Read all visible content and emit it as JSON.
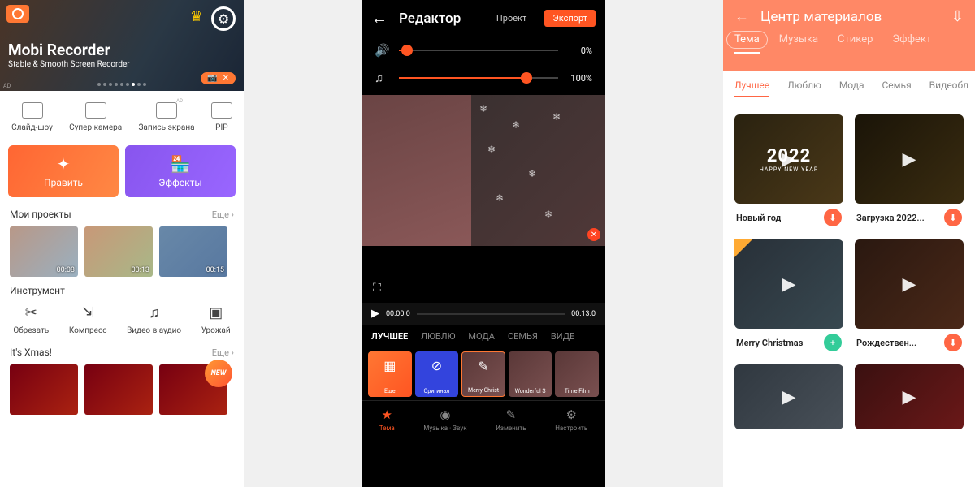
{
  "phone1": {
    "banner": {
      "title": "Mobi Recorder",
      "subtitle": "Stable & Smooth Screen Recorder",
      "ad": "AD"
    },
    "tools": [
      {
        "label": "Слайд-шоу"
      },
      {
        "label": "Супер камера"
      },
      {
        "label": "Запись экрана",
        "ad": "AD"
      },
      {
        "label": "PIP"
      }
    ],
    "edit_btn": "Править",
    "fx_btn": "Эффекты",
    "projects": {
      "title": "Мои проекты",
      "more": "Еще",
      "items": [
        {
          "dur": "00:08"
        },
        {
          "dur": "00:13"
        },
        {
          "dur": "00:15"
        }
      ]
    },
    "instruments": {
      "title": "Инструмент",
      "items": [
        {
          "label": "Обрезать"
        },
        {
          "label": "Компресс"
        },
        {
          "label": "Видео в аудио"
        },
        {
          "label": "Урожай"
        }
      ]
    },
    "xmas": {
      "title": "It's Xmas!",
      "more": "Еще",
      "new": "NEW"
    }
  },
  "phone2": {
    "title": "Редактор",
    "project": "Проект",
    "export": "Экспорт",
    "vol0": "0%",
    "vol100": "100%",
    "time_start": "00:00.0",
    "time_end": "00:13.0",
    "cats": [
      {
        "l": "ЛУЧШЕЕ",
        "a": true
      },
      {
        "l": "ЛЮБЛЮ"
      },
      {
        "l": "МОДА"
      },
      {
        "l": "СЕМЬЯ"
      },
      {
        "l": "ВИДЕ"
      }
    ],
    "presets": [
      {
        "l": "Еще",
        "t": "more"
      },
      {
        "l": "Оригинал",
        "t": "orig"
      },
      {
        "l": "Merry Christ",
        "t": "p",
        "sel": true
      },
      {
        "l": "Wonderful S",
        "t": "p"
      },
      {
        "l": "Time Film",
        "t": "p"
      }
    ],
    "nav": [
      {
        "l": "Тема",
        "a": true
      },
      {
        "l": "Музыка · Звук"
      },
      {
        "l": "Изменить"
      },
      {
        "l": "Настроить"
      }
    ]
  },
  "phone3": {
    "title": "Центр материалов",
    "tabs": [
      {
        "l": "Тема",
        "a": true
      },
      {
        "l": "Музыка"
      },
      {
        "l": "Стикер"
      },
      {
        "l": "Эффект"
      }
    ],
    "subtabs": [
      {
        "l": "Лучшее",
        "a": true
      },
      {
        "l": "Люблю"
      },
      {
        "l": "Мода"
      },
      {
        "l": "Семья"
      },
      {
        "l": "Видеобл"
      }
    ],
    "cards": [
      {
        "l": "Новый год",
        "btn": "dl",
        "img": "ny",
        "yr": "2022",
        "hny": "HAPPY NEW YEAR"
      },
      {
        "l": "Загрузка 2022...",
        "btn": "dl",
        "img": "ny2"
      },
      {
        "l": "Merry Christmas",
        "btn": "add",
        "img": "mc",
        "corner": true
      },
      {
        "l": "Рождествен...",
        "btn": "dl",
        "img": "rc"
      },
      {
        "l": "",
        "btn": "",
        "img": "b1"
      },
      {
        "l": "",
        "btn": "",
        "img": "b2"
      }
    ]
  }
}
